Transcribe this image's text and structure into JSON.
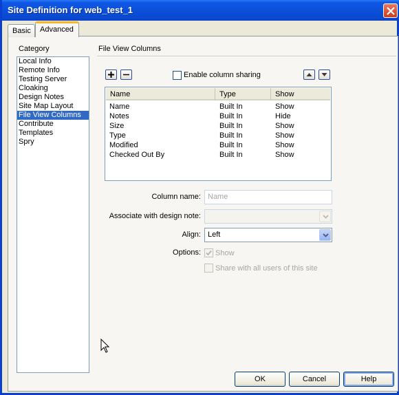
{
  "window": {
    "title": "Site Definition for web_test_1"
  },
  "tabs": [
    {
      "label": "Basic",
      "active": false
    },
    {
      "label": "Advanced",
      "active": true
    }
  ],
  "category": {
    "label": "Category",
    "items": [
      "Local Info",
      "Remote Info",
      "Testing Server",
      "Cloaking",
      "Design Notes",
      "Site Map Layout",
      "File View Columns",
      "Contribute",
      "Templates",
      "Spry"
    ],
    "selected_index": 6
  },
  "section": {
    "title": "File View Columns"
  },
  "toolbar": {
    "add_icon": "plus-icon",
    "remove_icon": "minus-icon",
    "enable_sharing_label": "Enable column sharing",
    "enable_sharing_checked": false,
    "move_up_icon": "arrow-up-icon",
    "move_down_icon": "arrow-down-icon"
  },
  "table": {
    "headers": [
      "Name",
      "Type",
      "Show"
    ],
    "rows": [
      [
        "Name",
        "Built In",
        "Show"
      ],
      [
        "Notes",
        "Built In",
        "Hide"
      ],
      [
        "Size",
        "Built In",
        "Show"
      ],
      [
        "Type",
        "Built In",
        "Show"
      ],
      [
        "Modified",
        "Built In",
        "Show"
      ],
      [
        "Checked Out By",
        "Built In",
        "Show"
      ]
    ]
  },
  "form": {
    "column_name_label": "Column name:",
    "column_name_placeholder": "Name",
    "design_note_label": "Associate with design note:",
    "design_note_value": "",
    "align_label": "Align:",
    "align_value": "Left",
    "options_label": "Options:",
    "show_label": "Show",
    "show_checked": true,
    "share_label": "Share with all users of this site",
    "share_checked": false
  },
  "buttons": {
    "ok": "OK",
    "cancel": "Cancel",
    "help": "Help"
  },
  "colors": {
    "titlebar": "#0b4fd8",
    "selection": "#316ac5",
    "tab_highlight": "#f4b72f"
  }
}
